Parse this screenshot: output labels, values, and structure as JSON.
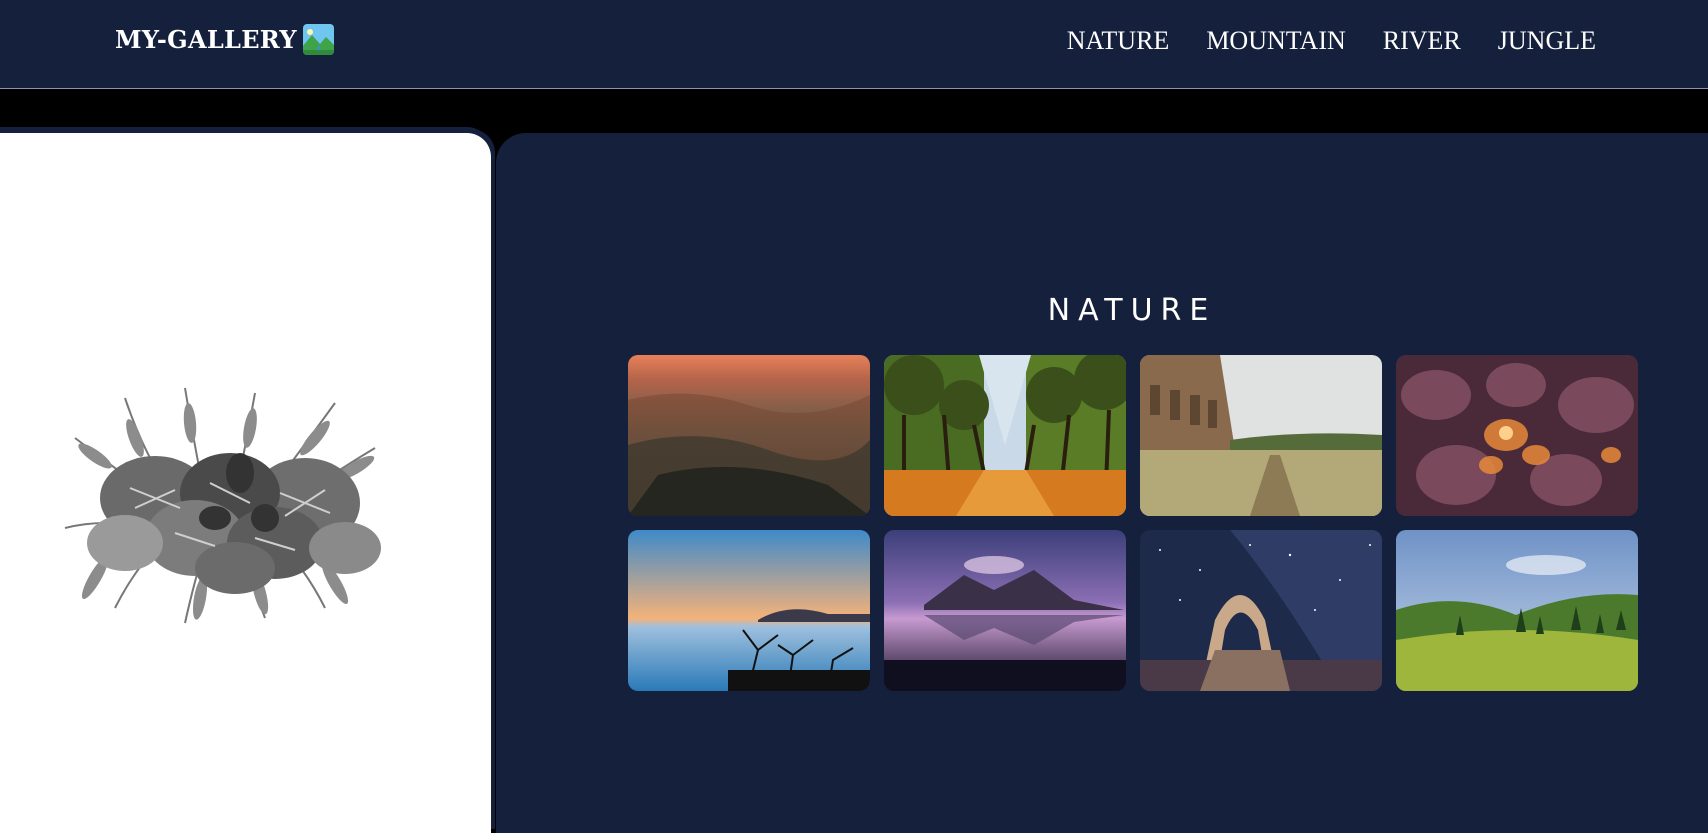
{
  "navbar": {
    "logo_text": "MY-GALLERY",
    "logo_icon": "landscape-emoji-icon",
    "links": [
      {
        "label": "NATURE"
      },
      {
        "label": "MOUNTAIN"
      },
      {
        "label": "RIVER"
      },
      {
        "label": "JUNGLE"
      }
    ]
  },
  "hero": {
    "image": "grayscale-tropical-leaves"
  },
  "gallery": {
    "title": "NATURE",
    "photos": [
      {
        "subject": "canyon-at-sunset"
      },
      {
        "subject": "tree-lined-autumn-path"
      },
      {
        "subject": "ancient-aqueduct-ruins-field"
      },
      {
        "subject": "purple-leaves-with-warm-light"
      },
      {
        "subject": "sea-of-clouds-at-dusk"
      },
      {
        "subject": "mountain-reflection-purple-sky"
      },
      {
        "subject": "rock-arch-under-milky-way"
      },
      {
        "subject": "green-hills-and-pine-trees"
      }
    ]
  },
  "colors": {
    "navy": "#15203c",
    "black": "#000000",
    "white": "#ffffff"
  }
}
